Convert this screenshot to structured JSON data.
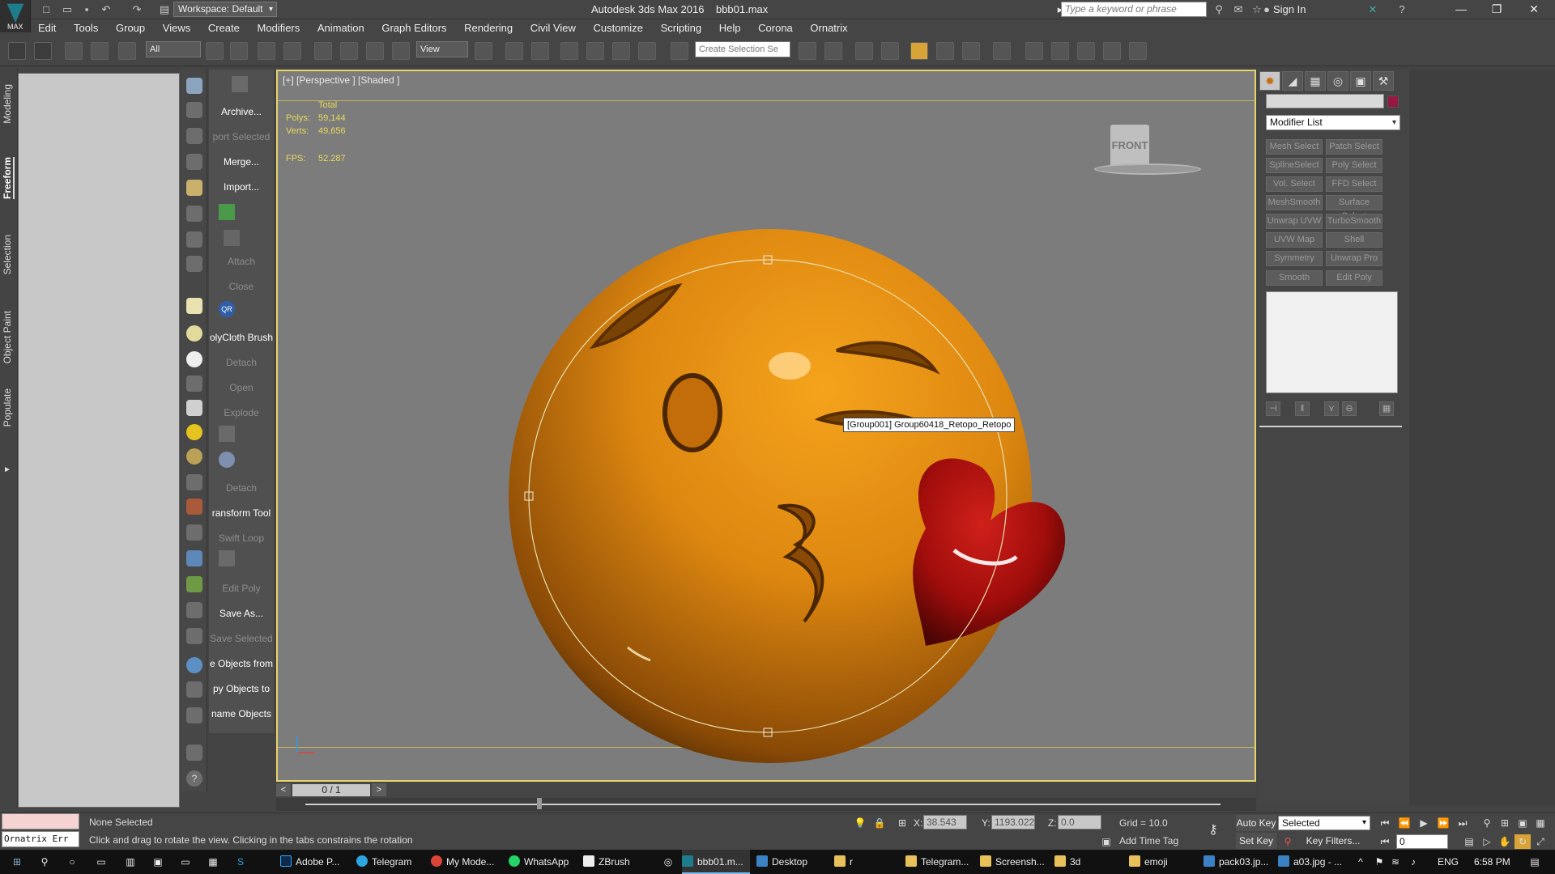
{
  "app": {
    "title": "Autodesk 3ds Max 2016",
    "filename": "bbb01.max",
    "logo_text": "MAX",
    "workspace": "Workspace: Default"
  },
  "search": {
    "placeholder": "Type a keyword or phrase"
  },
  "account": {
    "sign_in": "Sign In"
  },
  "menu": [
    "Edit",
    "Tools",
    "Group",
    "Views",
    "Create",
    "Modifiers",
    "Animation",
    "Graph Editors",
    "Rendering",
    "Civil View",
    "Customize",
    "Scripting",
    "Help",
    "Corona",
    "Ornatrix"
  ],
  "toolbar": {
    "selection_filter": "All",
    "ref_coord": "View",
    "named_selection": "Create Selection Se"
  },
  "ribbon_tabs": [
    "Modeling",
    "Freeform",
    "Selection",
    "Object Paint",
    "Populate"
  ],
  "tool_panel": {
    "archive": "Archive...",
    "export_selected": "port Selected",
    "merge": "Merge...",
    "import": "Import...",
    "qr": "QR",
    "attach": "Attach",
    "close": "Close",
    "polycloth_brush": "olyCloth Brush",
    "detach": "Detach",
    "open": "Open",
    "explode": "Explode",
    "detach2": "Detach",
    "transform_tool": "ransform Tool",
    "swift_loop": "Swift Loop",
    "edit_poly": "Edit Poly",
    "save_as": "Save As...",
    "save_selected": "Save Selected",
    "objects_from": "e Objects from",
    "copy_objects_to": "py Objects to",
    "rename_objects": "name Objects"
  },
  "viewport": {
    "label": "[+] [Perspective ] [Shaded ]",
    "stats": {
      "total": "Total",
      "polys_label": "Polys:",
      "polys": "59,144",
      "verts_label": "Verts:",
      "verts": "49,656",
      "fps_label": "FPS:",
      "fps": "52.287"
    },
    "viewcube": "FRONT",
    "tooltip": "[Group001] Group60418_Retopo_Retopo",
    "colors": {
      "face": "#e08a10",
      "heart": "#b3100e",
      "background": "#7c7c7c"
    }
  },
  "command_panel": {
    "modifier_list": "Modifier List",
    "modifiers": [
      "Mesh Select",
      "Patch Select",
      "SplineSelect",
      "Poly Select",
      "Vol. Select",
      "FFD Select",
      "MeshSmooth",
      "Surface Select",
      "Unwrap UVW",
      "TurboSmooth",
      "UVW Map",
      "Shell",
      "Symmetry",
      "Unwrap Pro",
      "Smooth",
      "Edit Poly"
    ],
    "swatch_color": "#961840"
  },
  "timeline": {
    "frame": "0 / 1",
    "prev": "<",
    "next": ">"
  },
  "status": {
    "selection": "None Selected",
    "prompt": "Click and drag to rotate the view.  Clicking in the tabs constrains the rotation",
    "maxscript": "Ornatrix Err",
    "x_label": "X:",
    "x": "38.543",
    "y_label": "Y:",
    "y": "1193.022",
    "z_label": "Z:",
    "z": "0.0",
    "grid": "Grid = 10.0",
    "add_time_tag": "Add Time Tag",
    "auto_key": "Auto Key",
    "set_key": "Set Key",
    "key_mode": "Selected",
    "key_filters": "Key Filters...",
    "frame": "0"
  },
  "taskbar": {
    "items": [
      "Adobe P...",
      "Telegram",
      "My Mode...",
      "WhatsApp",
      "ZBrush",
      "bbb01.m...",
      "Desktop",
      "r",
      "Telegram...",
      "Screensh...",
      "3d",
      "emoji",
      "pack03.jp...",
      "a03.jpg - ..."
    ],
    "lang": "ENG",
    "clock": "6:58 PM"
  }
}
